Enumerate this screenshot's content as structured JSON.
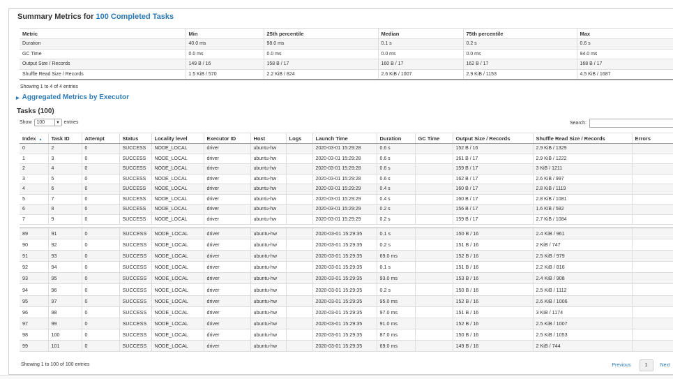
{
  "summary": {
    "title_prefix": "Summary Metrics for ",
    "title_link": "100 Completed Tasks",
    "headers": [
      "Metric",
      "Min",
      "25th percentile",
      "Median",
      "75th percentile",
      "Max"
    ],
    "rows": [
      [
        "Duration",
        "40.0 ms",
        "98.0 ms",
        "0.1 s",
        "0.2 s",
        "0.6 s"
      ],
      [
        "GC Time",
        "0.0 ms",
        "0.0 ms",
        "0.0 ms",
        "0.0 ms",
        "94.0 ms"
      ],
      [
        "Output Size / Records",
        "149 B / 16",
        "158 B / 17",
        "160 B / 17",
        "162 B / 17",
        "168 B / 17"
      ],
      [
        "Shuffle Read Size / Records",
        "1.5 KiB / 570",
        "2.2 KiB / 824",
        "2.6 KiB / 1007",
        "2.9 KiB / 1153",
        "4.5 KiB / 1687"
      ]
    ],
    "showing": "Showing 1 to 4 of 4 entries"
  },
  "aggregated": {
    "label": "Aggregated Metrics by Executor"
  },
  "tasks": {
    "title": "Tasks (100)",
    "show_label": "Show",
    "page_size": "100",
    "entries_label": "entries",
    "search_label": "Search:",
    "headers": [
      "Index",
      "Task ID",
      "Attempt",
      "Status",
      "Locality level",
      "Executor ID",
      "Host",
      "Logs",
      "Launch Time",
      "Duration",
      "GC Time",
      "Output Size / Records",
      "Shuffle Read Size / Records",
      "Errors"
    ],
    "rows_top": [
      [
        "0",
        "2",
        "0",
        "SUCCESS",
        "NODE_LOCAL",
        "driver",
        "ubuntu-hw",
        "",
        "2020-03-01 15:29:28",
        "0.6 s",
        "",
        "152 B / 16",
        "2.9 KiB / 1329",
        ""
      ],
      [
        "1",
        "3",
        "0",
        "SUCCESS",
        "NODE_LOCAL",
        "driver",
        "ubuntu-hw",
        "",
        "2020-03-01 15:29:28",
        "0.6 s",
        "",
        "161 B / 17",
        "2.9 KiB / 1222",
        ""
      ],
      [
        "2",
        "4",
        "0",
        "SUCCESS",
        "NODE_LOCAL",
        "driver",
        "ubuntu-hw",
        "",
        "2020-03-01 15:29:28",
        "0.6 s",
        "",
        "159 B / 17",
        "3 KiB / 1211",
        ""
      ],
      [
        "3",
        "5",
        "0",
        "SUCCESS",
        "NODE_LOCAL",
        "driver",
        "ubuntu-hw",
        "",
        "2020-03-01 15:29:28",
        "0.6 s",
        "",
        "162 B / 17",
        "2.6 KiB / 997",
        ""
      ],
      [
        "4",
        "6",
        "0",
        "SUCCESS",
        "NODE_LOCAL",
        "driver",
        "ubuntu-hw",
        "",
        "2020-03-01 15:29:29",
        "0.4 s",
        "",
        "160 B / 17",
        "2.8 KiB / 1119",
        ""
      ],
      [
        "5",
        "7",
        "0",
        "SUCCESS",
        "NODE_LOCAL",
        "driver",
        "ubuntu-hw",
        "",
        "2020-03-01 15:29:29",
        "0.4 s",
        "",
        "160 B / 17",
        "2.8 KiB / 1081",
        ""
      ],
      [
        "6",
        "8",
        "0",
        "SUCCESS",
        "NODE_LOCAL",
        "driver",
        "ubuntu-hw",
        "",
        "2020-03-01 15:29:29",
        "0.2 s",
        "",
        "156 B / 17",
        "1.6 KiB / 582",
        ""
      ],
      [
        "7",
        "9",
        "0",
        "SUCCESS",
        "NODE_LOCAL",
        "driver",
        "ubuntu-hw",
        "",
        "2020-03-01 15:29:29",
        "0.2 s",
        "",
        "159 B / 17",
        "2.7 KiB / 1084",
        ""
      ]
    ],
    "rows_bottom": [
      [
        "89",
        "91",
        "0",
        "SUCCESS",
        "NODE_LOCAL",
        "driver",
        "ubuntu-hw",
        "",
        "2020-03-01 15:29:35",
        "0.1 s",
        "",
        "150 B / 16",
        "2.4 KiB / 961",
        ""
      ],
      [
        "90",
        "92",
        "0",
        "SUCCESS",
        "NODE_LOCAL",
        "driver",
        "ubuntu-hw",
        "",
        "2020-03-01 15:29:35",
        "0.2 s",
        "",
        "151 B / 16",
        "2 KiB / 747",
        ""
      ],
      [
        "91",
        "93",
        "0",
        "SUCCESS",
        "NODE_LOCAL",
        "driver",
        "ubuntu-hw",
        "",
        "2020-03-01 15:29:35",
        "69.0 ms",
        "",
        "152 B / 16",
        "2.5 KiB / 979",
        ""
      ],
      [
        "92",
        "94",
        "0",
        "SUCCESS",
        "NODE_LOCAL",
        "driver",
        "ubuntu-hw",
        "",
        "2020-03-01 15:29:35",
        "0.1 s",
        "",
        "151 B / 16",
        "2.2 KiB / 816",
        ""
      ],
      [
        "93",
        "95",
        "0",
        "SUCCESS",
        "NODE_LOCAL",
        "driver",
        "ubuntu-hw",
        "",
        "2020-03-01 15:29:35",
        "93.0 ms",
        "",
        "153 B / 16",
        "2.4 KiB / 908",
        ""
      ],
      [
        "94",
        "96",
        "0",
        "SUCCESS",
        "NODE_LOCAL",
        "driver",
        "ubuntu-hw",
        "",
        "2020-03-01 15:29:35",
        "0.2 s",
        "",
        "150 B / 16",
        "2.5 KiB / 1112",
        ""
      ],
      [
        "95",
        "97",
        "0",
        "SUCCESS",
        "NODE_LOCAL",
        "driver",
        "ubuntu-hw",
        "",
        "2020-03-01 15:29:35",
        "95.0 ms",
        "",
        "152 B / 16",
        "2.6 KiB / 1006",
        ""
      ],
      [
        "96",
        "98",
        "0",
        "SUCCESS",
        "NODE_LOCAL",
        "driver",
        "ubuntu-hw",
        "",
        "2020-03-01 15:29:35",
        "97.0 ms",
        "",
        "151 B / 16",
        "3 KiB / 1174",
        ""
      ],
      [
        "97",
        "99",
        "0",
        "SUCCESS",
        "NODE_LOCAL",
        "driver",
        "ubuntu-hw",
        "",
        "2020-03-01 15:29:35",
        "91.0 ms",
        "",
        "152 B / 16",
        "2.5 KiB / 1007",
        ""
      ],
      [
        "98",
        "100",
        "0",
        "SUCCESS",
        "NODE_LOCAL",
        "driver",
        "ubuntu-hw",
        "",
        "2020-03-01 15:29:35",
        "87.0 ms",
        "",
        "150 B / 16",
        "2.5 KiB / 1053",
        ""
      ],
      [
        "99",
        "101",
        "0",
        "SUCCESS",
        "NODE_LOCAL",
        "driver",
        "ubuntu-hw",
        "",
        "2020-03-01 15:29:35",
        "69.0 ms",
        "",
        "149 B / 16",
        "2 KiB / 744",
        ""
      ]
    ],
    "showing": "Showing 1 to 100 of 100 entries",
    "pager": {
      "previous": "Previous",
      "page": "1",
      "next": "Next"
    }
  },
  "colors": {
    "link": "#2a7ab8",
    "row_stripe": "#f5f5f5",
    "border": "#dddddd"
  },
  "icons": {
    "sort": "sort-asc-icon",
    "expand": "triangle-right-icon",
    "dropdown": "chevron-down-icon"
  }
}
